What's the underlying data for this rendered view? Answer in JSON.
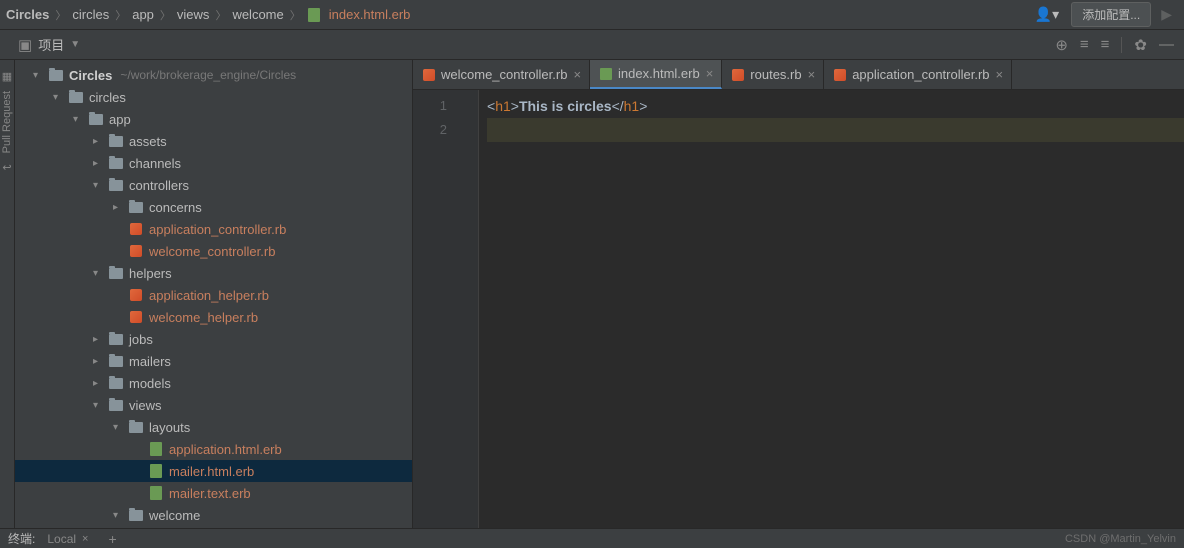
{
  "breadcrumbs": {
    "items": [
      {
        "label": "Circles",
        "bold": true
      },
      {
        "label": "circles"
      },
      {
        "label": "app"
      },
      {
        "label": "views"
      },
      {
        "label": "welcome"
      },
      {
        "label": "index.html.erb",
        "file": true
      }
    ]
  },
  "top_right": {
    "config_label": "添加配置..."
  },
  "toolbar": {
    "project_label": "项目"
  },
  "tree": {
    "root_name": "Circles",
    "root_path": "~/work/brokerage_engine/Circles",
    "items": [
      {
        "label": "circles",
        "indent": 1,
        "type": "folder",
        "arrow": "down"
      },
      {
        "label": "app",
        "indent": 2,
        "type": "folder",
        "arrow": "down"
      },
      {
        "label": "assets",
        "indent": 3,
        "type": "folder",
        "arrow": "right"
      },
      {
        "label": "channels",
        "indent": 3,
        "type": "folder",
        "arrow": "right"
      },
      {
        "label": "controllers",
        "indent": 3,
        "type": "folder",
        "arrow": "down"
      },
      {
        "label": "concerns",
        "indent": 4,
        "type": "folder",
        "arrow": "right"
      },
      {
        "label": "application_controller.rb",
        "indent": 4,
        "type": "ruby",
        "orange": true
      },
      {
        "label": "welcome_controller.rb",
        "indent": 4,
        "type": "ruby",
        "orange": true
      },
      {
        "label": "helpers",
        "indent": 3,
        "type": "folder",
        "arrow": "down"
      },
      {
        "label": "application_helper.rb",
        "indent": 4,
        "type": "ruby",
        "orange": true
      },
      {
        "label": "welcome_helper.rb",
        "indent": 4,
        "type": "ruby",
        "orange": true
      },
      {
        "label": "jobs",
        "indent": 3,
        "type": "folder",
        "arrow": "right"
      },
      {
        "label": "mailers",
        "indent": 3,
        "type": "folder",
        "arrow": "right"
      },
      {
        "label": "models",
        "indent": 3,
        "type": "folder",
        "arrow": "right"
      },
      {
        "label": "views",
        "indent": 3,
        "type": "folder",
        "arrow": "down"
      },
      {
        "label": "layouts",
        "indent": 4,
        "type": "folder",
        "arrow": "down"
      },
      {
        "label": "application.html.erb",
        "indent": 5,
        "type": "erb",
        "orange": true
      },
      {
        "label": "mailer.html.erb",
        "indent": 5,
        "type": "erb",
        "orange": true,
        "selected": true
      },
      {
        "label": "mailer.text.erb",
        "indent": 5,
        "type": "erb",
        "orange": true
      },
      {
        "label": "welcome",
        "indent": 4,
        "type": "folder",
        "arrow": "down"
      }
    ]
  },
  "tabs": [
    {
      "label": "welcome_controller.rb",
      "type": "ruby",
      "orange": false
    },
    {
      "label": "index.html.erb",
      "type": "erb",
      "active": true
    },
    {
      "label": "routes.rb",
      "type": "ruby"
    },
    {
      "label": "application_controller.rb",
      "type": "ruby"
    }
  ],
  "editor": {
    "lines": [
      "1",
      "2"
    ],
    "code": {
      "open_bracket": "<",
      "tag": "h1",
      "close_bracket": ">",
      "text": "This is circles",
      "open_close": "</",
      "end_bracket": ">"
    }
  },
  "bottom": {
    "terminal_label": "终端:",
    "sub_label": "Local",
    "watermark": "CSDN @Martin_Yelvin"
  },
  "side_gutter": {
    "label": "Pull Request"
  }
}
